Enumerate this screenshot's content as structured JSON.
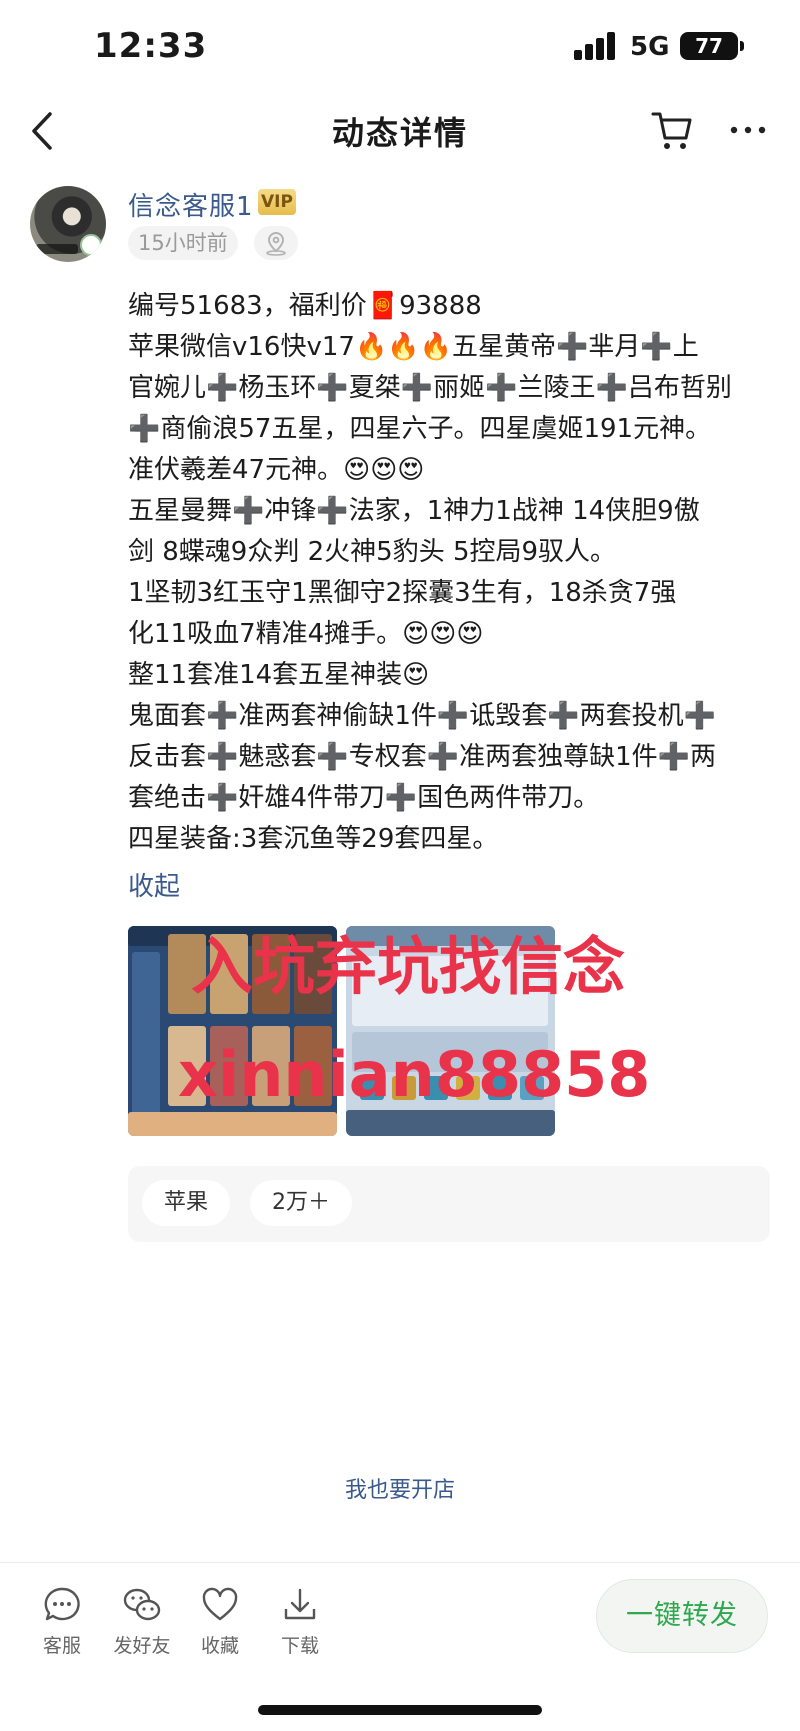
{
  "status_bar": {
    "time": "12:33",
    "network": "5G",
    "battery": "77"
  },
  "nav": {
    "title": "动态详情",
    "back_icon": "chevron-left-icon",
    "cart_icon": "cart-icon",
    "more_icon": "more-icon"
  },
  "author": {
    "name": "信念客服1",
    "badge": "VIP",
    "time": "15小时前",
    "location_icon": "location-icon"
  },
  "post": {
    "lines": [
      "编号51683，福利价🧧93888",
      "苹果微信v16快v17🔥🔥🔥五星黄帝➕芈月➕上",
      "官婉儿➕杨玉环➕夏桀➕丽姬➕兰陵王➕吕布哲别",
      "➕商偷浪57五星，四星六子。四星虞姬191元神。",
      "准伏羲差47元神。😍😍😍",
      "五星曼舞➕冲锋➕法家，1神力1战神 14侠胆9傲",
      "剑 8蝶魂9众判 2火神5豹头 5控局9驭人。",
      "1坚韧3红玉守1黑御守2探囊3生有，18杀贪7强",
      "化11吸血7精准4摊手。😍😍😍",
      "整11套准14套五星神装😍",
      "鬼面套➕准两套神偷缺1件➕诋毁套➕两套投机➕",
      "反击套➕魅惑套➕专权套➕准两套独尊缺1件➕两",
      "套绝击➕奸雄4件带刀➕国色两件带刀。",
      "四星装备:3套沉鱼等29套四星。"
    ],
    "collapse": "收起",
    "watermark_line1": "入坑弃坑找信念",
    "watermark_line2": "xinnian88858"
  },
  "tags": [
    "苹果",
    "2万＋"
  ],
  "open_shop": "我也要开店",
  "bottom_bar": {
    "actions": [
      {
        "label": "客服",
        "icon": "chat-icon"
      },
      {
        "label": "发好友",
        "icon": "wechat-icon"
      },
      {
        "label": "收藏",
        "icon": "heart-icon"
      },
      {
        "label": "下载",
        "icon": "download-icon"
      }
    ],
    "forward_label": "一键转发"
  }
}
